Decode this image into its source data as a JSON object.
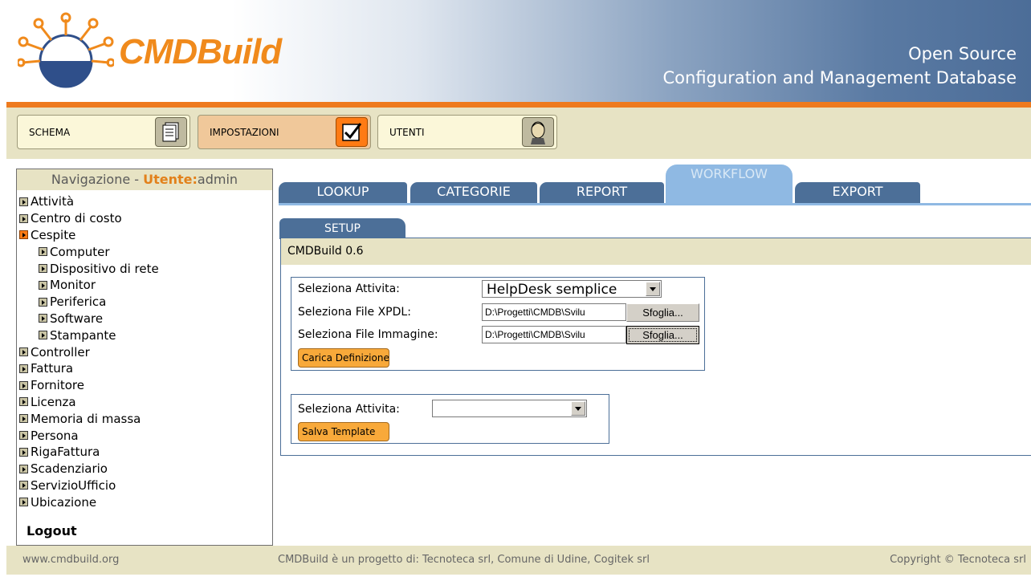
{
  "header": {
    "logo_text": "CMDBuild",
    "tagline_line1": "Open Source",
    "tagline_line2": "Configuration and Management Database"
  },
  "modules": [
    {
      "label": "SCHEMA",
      "icon": "schema-icon",
      "active": false
    },
    {
      "label": "IMPOSTAZIONI",
      "icon": "settings-check-icon",
      "active": true
    },
    {
      "label": "UTENTI",
      "icon": "user-icon",
      "active": false
    }
  ],
  "nav": {
    "title_prefix": "Navigazione - ",
    "user_label": "Utente:",
    "user_name": "admin",
    "items": [
      {
        "label": "Attività",
        "level": 0,
        "open": false
      },
      {
        "label": "Centro di costo",
        "level": 0,
        "open": false
      },
      {
        "label": "Cespite",
        "level": 0,
        "open": true
      },
      {
        "label": "Computer",
        "level": 1,
        "open": false
      },
      {
        "label": "Dispositivo di rete",
        "level": 1,
        "open": false
      },
      {
        "label": "Monitor",
        "level": 1,
        "open": false
      },
      {
        "label": "Periferica",
        "level": 1,
        "open": false
      },
      {
        "label": "Software",
        "level": 1,
        "open": false
      },
      {
        "label": "Stampante",
        "level": 1,
        "open": false
      },
      {
        "label": "Controller",
        "level": 0,
        "open": false
      },
      {
        "label": "Fattura",
        "level": 0,
        "open": false
      },
      {
        "label": "Fornitore",
        "level": 0,
        "open": false
      },
      {
        "label": "Licenza",
        "level": 0,
        "open": false
      },
      {
        "label": "Memoria di massa",
        "level": 0,
        "open": false
      },
      {
        "label": "Persona",
        "level": 0,
        "open": false
      },
      {
        "label": "RigaFattura",
        "level": 0,
        "open": false
      },
      {
        "label": "Scadenziario",
        "level": 0,
        "open": false
      },
      {
        "label": "ServizioUfficio",
        "level": 0,
        "open": false
      },
      {
        "label": "Ubicazione",
        "level": 0,
        "open": false
      }
    ],
    "logout": "Logout"
  },
  "tabs": [
    {
      "label": "LOOKUP",
      "active": false
    },
    {
      "label": "CATEGORIE",
      "active": false
    },
    {
      "label": "REPORT",
      "active": false
    },
    {
      "label": "WORKFLOW",
      "active": true
    },
    {
      "label": "EXPORT",
      "active": false
    }
  ],
  "subtab": {
    "label": "SETUP"
  },
  "panel": {
    "title": "CMDBuild 0.6",
    "form1": {
      "activity_label": "Seleziona Attivita:",
      "activity_value": "HelpDesk semplice",
      "xpdl_label": "Seleziona File XPDL:",
      "xpdl_value": "D:\\Progetti\\CMDB\\Svilu",
      "image_label": "Seleziona File Immagine:",
      "image_value": "D:\\Progetti\\CMDB\\Svilu",
      "browse_label": "Sfoglia...",
      "submit_label": "Carica Definizione"
    },
    "form2": {
      "activity_label": "Seleziona Attivita:",
      "activity_value": "",
      "submit_label": "Salva Template"
    }
  },
  "footer": {
    "left": "www.cmdbuild.org",
    "center": "CMDBuild è un progetto di: Tecnoteca srl, Comune di Udine, Cogitek srl",
    "right": "Copyright © Tecnoteca srl"
  }
}
